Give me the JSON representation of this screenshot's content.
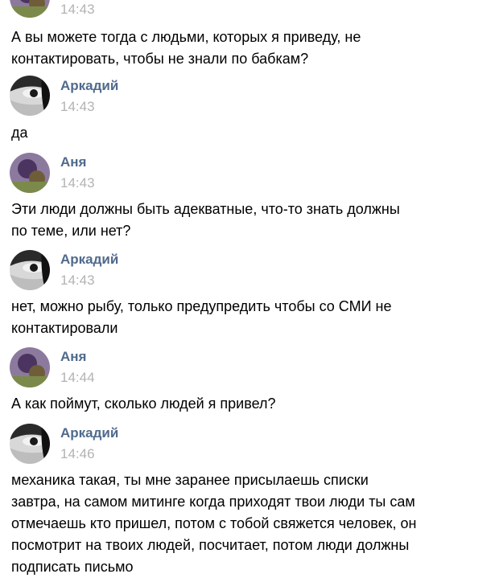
{
  "messages": [
    {
      "author": "",
      "time": "14:43",
      "avatar": "anya-avatar",
      "lines": [
        "А вы можете тогда с людьми, которых я приведу, не",
        "контактировать, чтобы не знали по бабкам?"
      ]
    },
    {
      "author": "Аркадий",
      "time": "14:43",
      "avatar": "arkady-avatar",
      "lines": [
        "да"
      ]
    },
    {
      "author": "Аня",
      "time": "14:43",
      "avatar": "anya-avatar",
      "lines": [
        "Эти люди должны быть адекватные, что-то знать должны",
        "по теме, или нет?"
      ]
    },
    {
      "author": "Аркадий",
      "time": "14:43",
      "avatar": "arkady-avatar",
      "lines": [
        "нет, можно рыбу, только предупредить чтобы со СМИ не",
        "контактировали"
      ]
    },
    {
      "author": "Аня",
      "time": "14:44",
      "avatar": "anya-avatar",
      "lines": [
        "А как поймут, сколько людей я привел?"
      ]
    },
    {
      "author": "Аркадий",
      "time": "14:46",
      "avatar": "arkady-avatar",
      "lines": [
        "механика такая, ты мне заранее присылаешь списки",
        "завтра, на самом митинге когда приходят твои люди ты сам",
        "отмечаешь кто пришел, потом с тобой свяжется человек, он",
        "посмотрит на твоих людей, посчитает, потом люди должны",
        "подписать письмо"
      ]
    }
  ],
  "colors": {
    "name": "#506a8c",
    "time": "#b3b3b3",
    "text": "#000000",
    "background": "#ffffff"
  }
}
